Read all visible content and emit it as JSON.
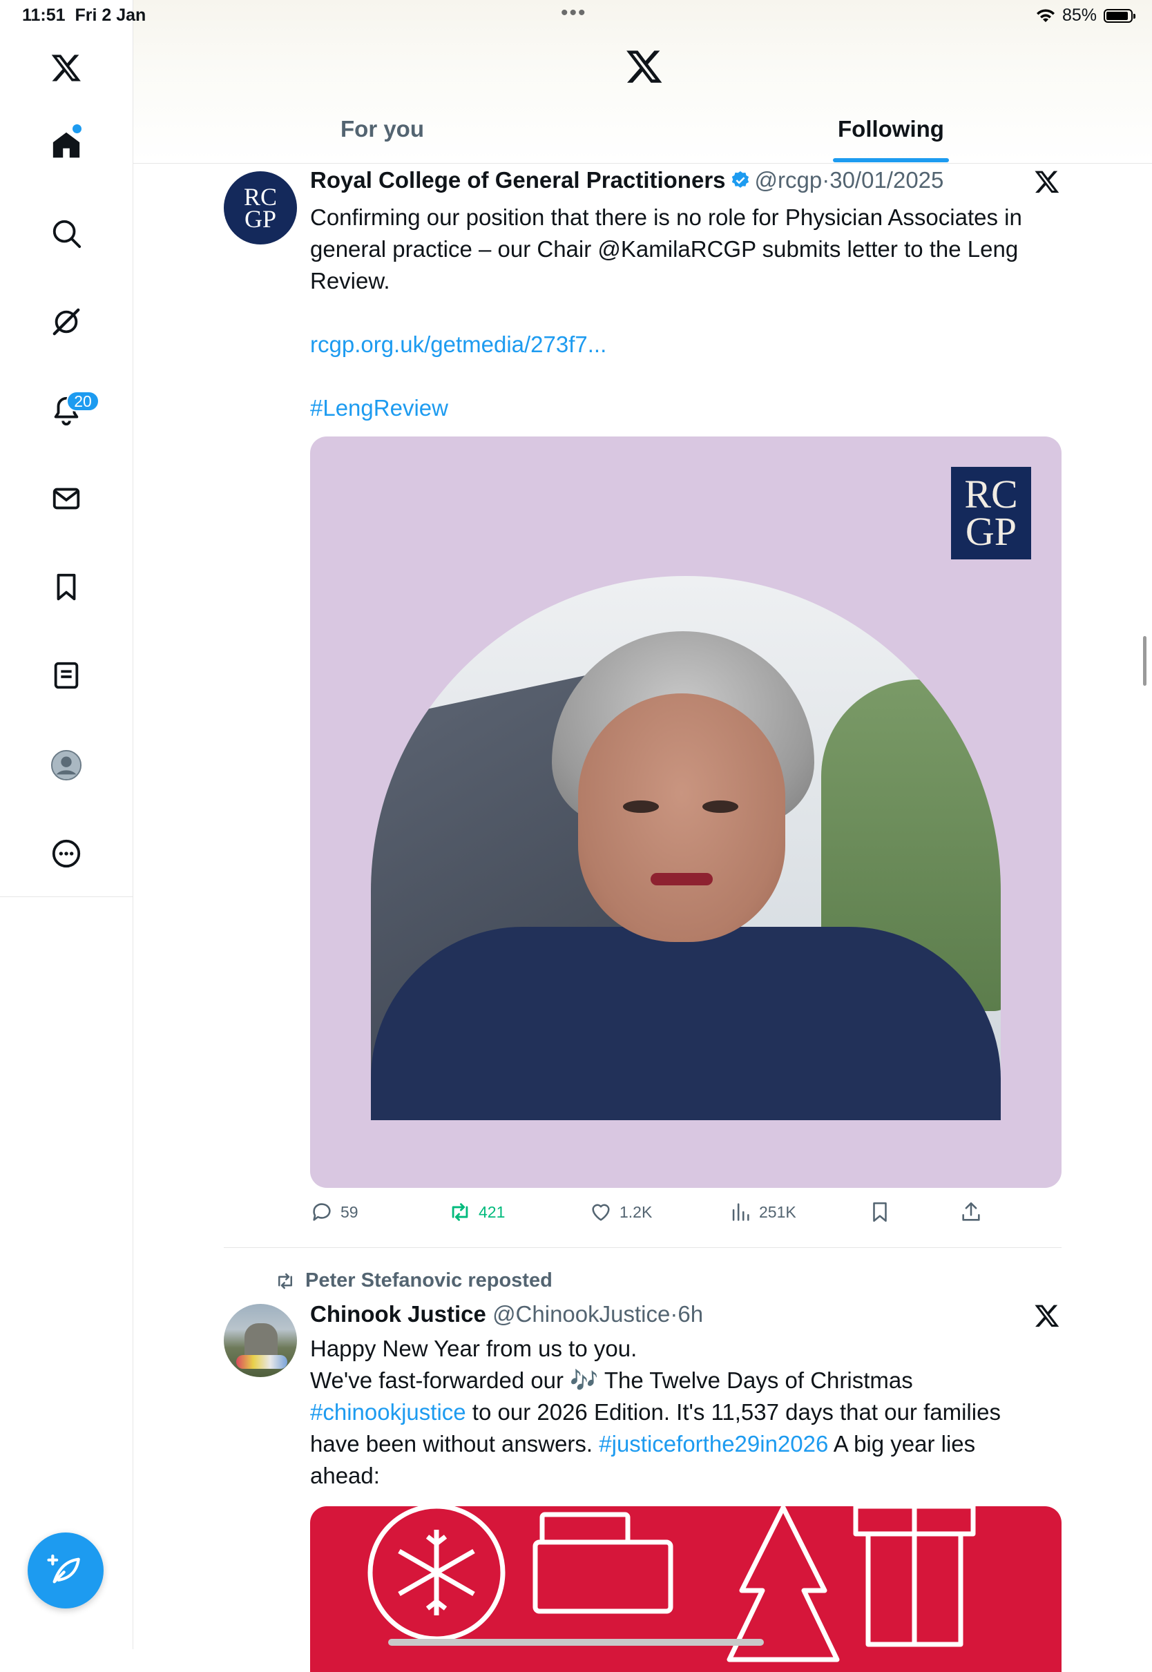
{
  "status_bar": {
    "time": "11:51",
    "date": "Fri 2 Jan",
    "battery": "85%",
    "dots": "•••"
  },
  "sidebar": {
    "items": [
      {
        "name": "x-logo-icon"
      },
      {
        "name": "home-icon"
      },
      {
        "name": "search-icon"
      },
      {
        "name": "grok-icon"
      },
      {
        "name": "bell-icon"
      },
      {
        "name": "mail-icon"
      },
      {
        "name": "bookmark-icon"
      },
      {
        "name": "lists-icon"
      },
      {
        "name": "profile-icon"
      },
      {
        "name": "more-icon"
      }
    ],
    "notification_count": "20",
    "compose_icon": "compose-icon"
  },
  "header": {
    "tabs": [
      {
        "label": "For you"
      },
      {
        "label": "Following"
      }
    ],
    "active_tab": "Following"
  },
  "tweet1": {
    "avatar_text_top": "RC",
    "avatar_text_bottom": "GP",
    "name": "Royal College of General Practitioners",
    "handle": "@rcgp",
    "sep": "·",
    "date": "30/01/2025",
    "text_line1": "Confirming our position that there is no role for Physician Associates in",
    "text_line2": "general practice – our Chair @KamilaRCGP submits letter to the Leng",
    "text_line3": "Review.",
    "link": "rcgp.org.uk/getmedia/273f7...",
    "hashtag": "#LengReview",
    "image_logo_top": "RC",
    "image_logo_bottom": "GP",
    "replies": "59",
    "reposts": "421",
    "likes": "1.2K",
    "views": "251K",
    "repost_color": "#00ba7c"
  },
  "tweet2": {
    "repost_label": "Peter Stefanovic reposted",
    "name": "Chinook Justice",
    "handle": "@ChinookJustice",
    "sep": "·",
    "time": "6h",
    "line1": "Happy New Year from us to you.",
    "line2_a": "We've fast-forwarded our ",
    "line2_emoji": "🎶",
    "line2_b": " The Twelve Days of Christmas",
    "line3_tag": "#chinookjustice",
    "line3_rest": " to our 2026 Edition. It's 11,537 days that our families",
    "line4_a": "have been without answers. ",
    "line4_tag": "#justiceforthe29in2026",
    "line4_b": " A big year lies",
    "line5": "ahead:"
  },
  "colors": {
    "accent": "#1d9bf0",
    "text": "#0f1419",
    "muted": "#536471",
    "repost_green": "#00ba7c",
    "rcgp_navy": "#14295b"
  }
}
